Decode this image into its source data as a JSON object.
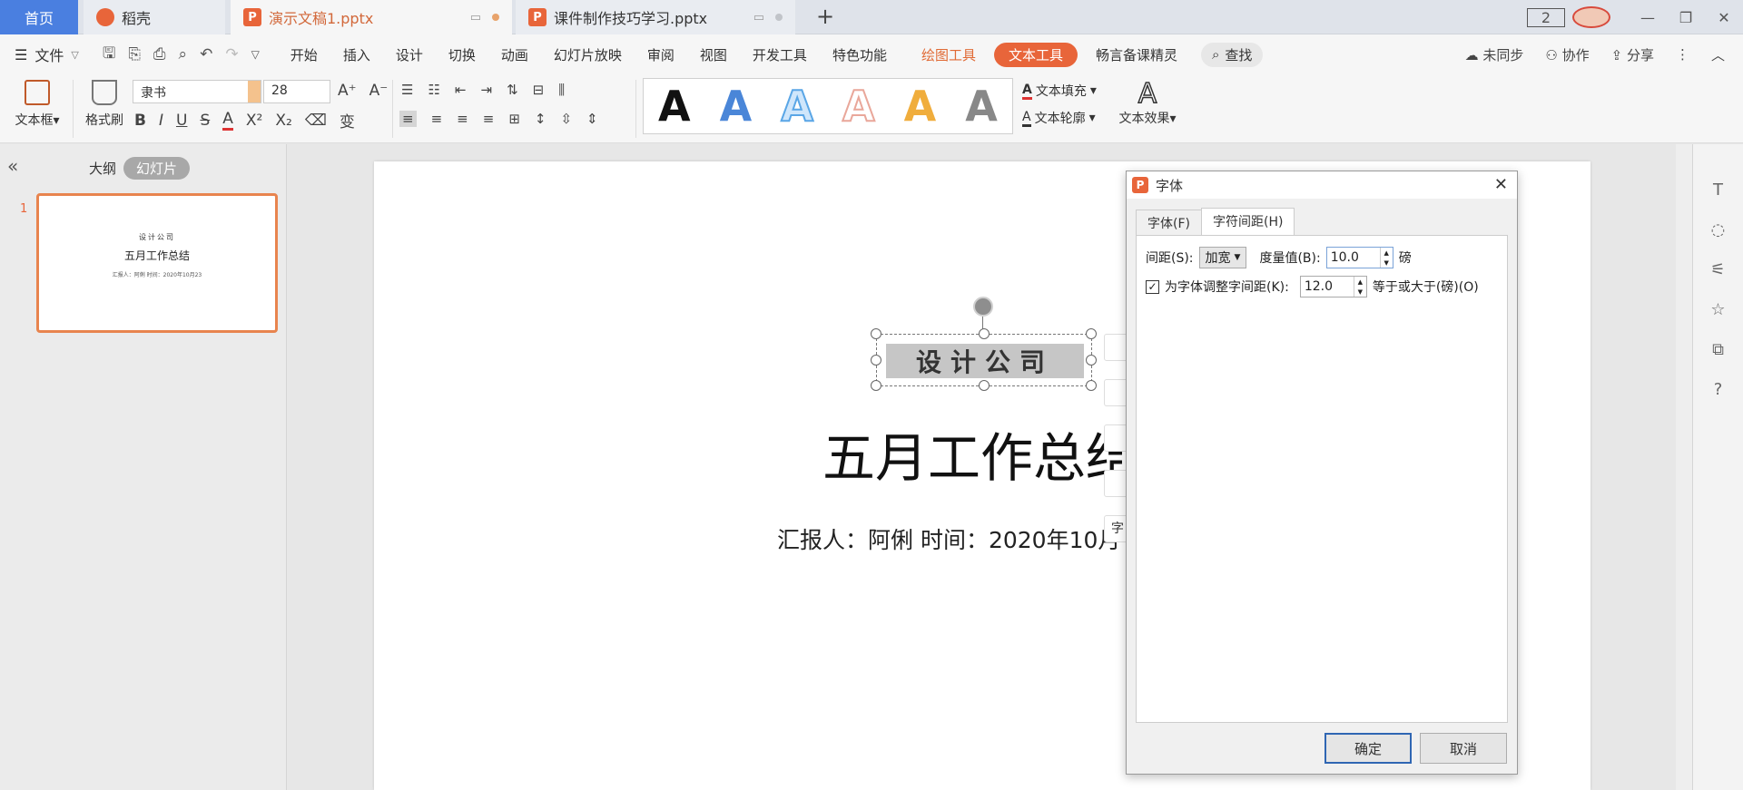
{
  "tabs": {
    "home": "首页",
    "daoke": "稻壳",
    "active_doc": "演示文稿1.pptx",
    "course_doc": "课件制作技巧学习.pptx",
    "ppt_icon_letter": "P",
    "new_tab": "+",
    "window_count": "2"
  },
  "menu": {
    "file": "文件",
    "items": [
      "开始",
      "插入",
      "设计",
      "切换",
      "动画",
      "幻灯片放映",
      "审阅",
      "视图",
      "开发工具",
      "特色功能"
    ],
    "drawing_tools": "绘图工具",
    "text_tools": "文本工具",
    "changyan": "畅言备课精灵",
    "search": "查找",
    "unsynced": "未同步",
    "collab": "协作",
    "share": "分享"
  },
  "ribbon": {
    "textbox": "文本框",
    "format_painter": "格式刷",
    "font_name": "隶书",
    "font_size": "28",
    "text_fill": "文本填充",
    "text_outline": "文本轮廓",
    "text_effect": "文本效果",
    "style_letter": "A",
    "style_colors": [
      "#111111",
      "#4a86d8",
      "#5aa6e6",
      "#e9a79a",
      "#f0ad3c",
      "#888888"
    ]
  },
  "left_panel": {
    "outline_tab": "大纲",
    "slides_tab": "幻灯片",
    "slide_number": "1",
    "thumb_line1": "设计公司",
    "thumb_title": "五月工作总结",
    "thumb_sub": "汇报人：阿俐 时间：2020年10月23"
  },
  "slide": {
    "company": "设计公司",
    "title": "五月工作总结",
    "subtitle": "汇报人：阿俐 时间：2020年10月",
    "side_char": "字"
  },
  "dialog": {
    "title": "字体",
    "tab_font": "字体(F)",
    "tab_spacing": "字符间距(H)",
    "spacing_label": "间距(S):",
    "spacing_value": "加宽",
    "measure_label": "度量值(B):",
    "measure_value": "10.0",
    "unit": "磅",
    "kerning_checked": true,
    "kerning_label": "为字体调整字间距(K):",
    "kerning_value": "12.0",
    "kerning_suffix": "等于或大于(磅)(O)",
    "ok": "确定",
    "cancel": "取消"
  },
  "colors": {
    "accent": "#e8653a",
    "home_tab": "#4a7fe0",
    "primary_button_border": "#2f66b3"
  }
}
